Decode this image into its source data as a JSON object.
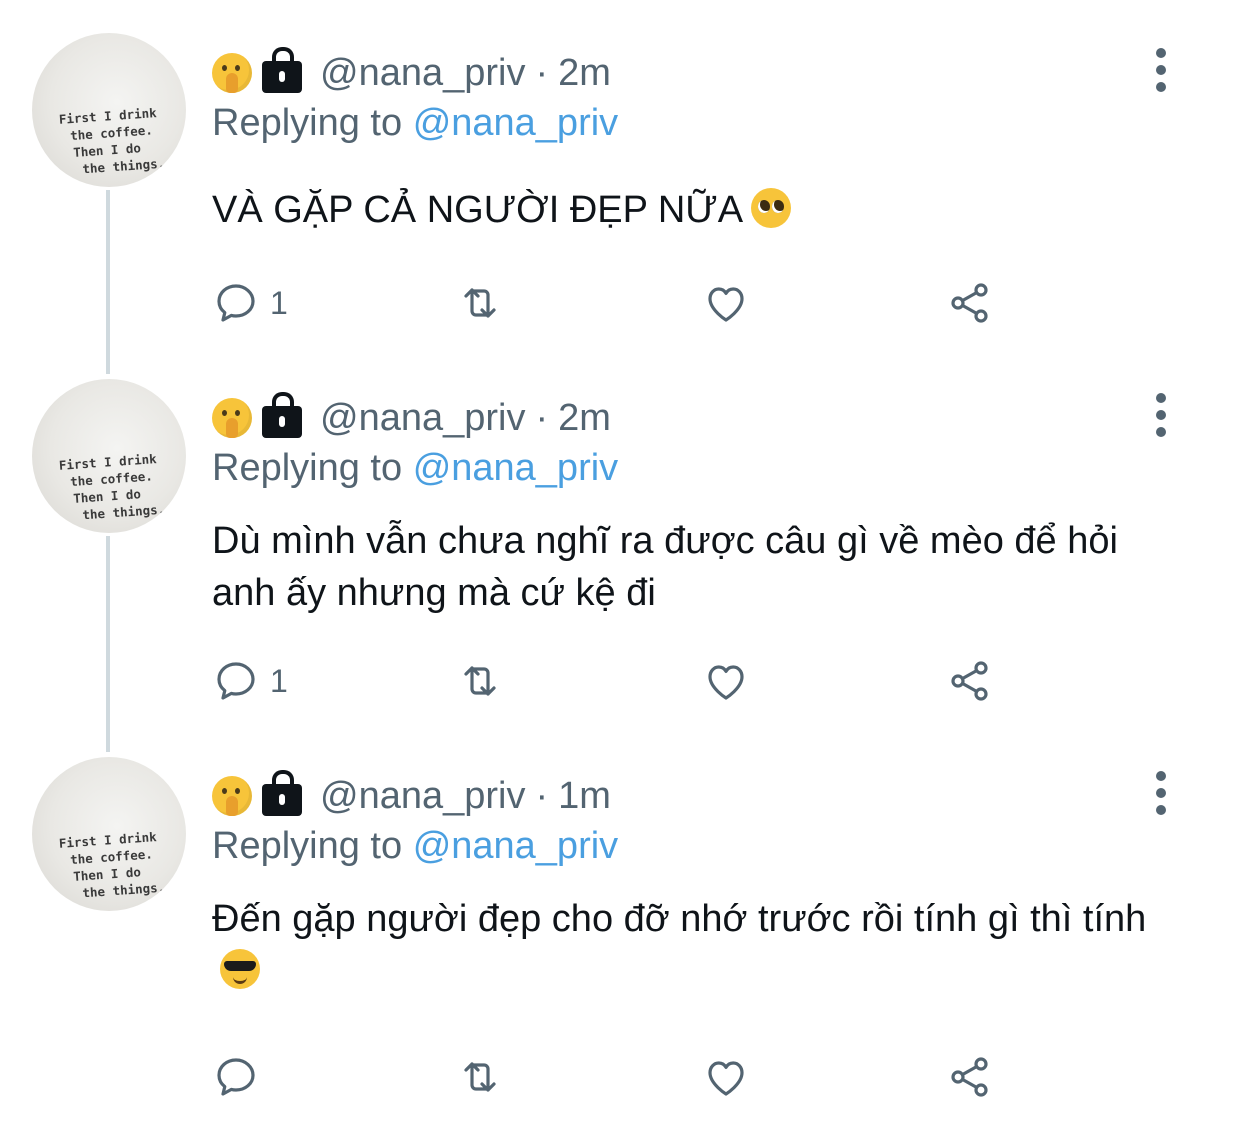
{
  "tweets": [
    {
      "handle": "@nana_priv",
      "time": "2m",
      "replying_label": "Replying to",
      "replying_to": "@nana_priv",
      "text": "VÀ GẶP CẢ NGƯỜI ĐẸP NỮA",
      "reply_count": "1",
      "emoji": "pleading-face-emoji"
    },
    {
      "handle": "@nana_priv",
      "time": "2m",
      "replying_label": "Replying to",
      "replying_to": "@nana_priv",
      "text": "Dù mình vẫn chưa nghĩ ra được câu gì về mèo để hỏi anh ấy nhưng mà cứ kệ đi",
      "reply_count": "1"
    },
    {
      "handle": "@nana_priv",
      "time": "1m",
      "replying_label": "Replying to",
      "replying_to": "@nana_priv",
      "text": "Đến gặp người đẹp cho đỡ nhớ trước rồi tính gì thì tính",
      "reply_count": "",
      "emoji": "sunglasses-face-emoji"
    }
  ],
  "avatar_text": [
    "First I drink",
    "the coffee.",
    "Then I do",
    "the things."
  ],
  "colors": {
    "secondary_text": "#536471",
    "mention": "#4a9fe0",
    "primary_text": "#0f1419",
    "thread_line": "#cfd9de"
  },
  "icons": [
    "shushing-face-emoji",
    "lock-icon",
    "more-options-icon",
    "reply-icon",
    "retweet-icon",
    "like-icon",
    "share-icon"
  ]
}
